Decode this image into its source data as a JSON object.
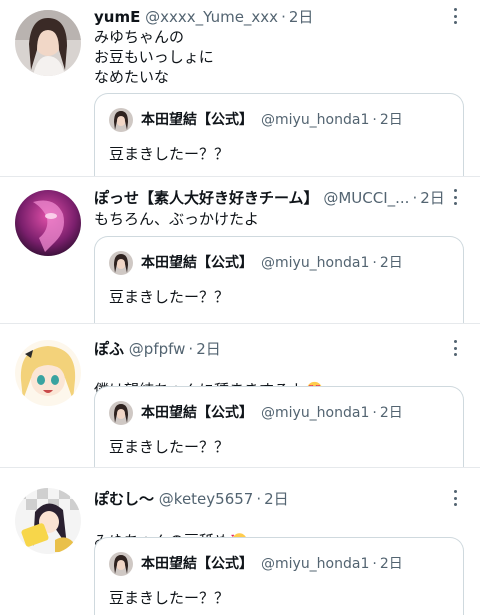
{
  "tweets": [
    {
      "name": "yumE",
      "handle": "@xxxx_Yume_xxx",
      "time": "2日",
      "text": "みゆちゃんの\nお豆もいっしょに\nなめたいな",
      "emoji": "",
      "quote": {
        "name": "本田望結【公式】",
        "handle": "@miyu_honda1",
        "time": "2日",
        "text": "豆まきしたー？？"
      }
    },
    {
      "name": "ぽっせ【素人大好き好きチーム】",
      "handle": "@MUCCI_...",
      "time": "2日",
      "text": "もちろん、ぶっかけたよ",
      "emoji": "",
      "quote": {
        "name": "本田望結【公式】",
        "handle": "@miyu_honda1",
        "time": "2日",
        "text": "豆まきしたー？？"
      }
    },
    {
      "name": "ぽふ",
      "handle": "@pfpfw",
      "time": "2日",
      "text": "僕は望結ちゃんに種まきするよ",
      "emoji": "heart-eyes-face-icon",
      "quote": {
        "name": "本田望結【公式】",
        "handle": "@miyu_honda1",
        "time": "2日",
        "text": "豆まきしたー？？"
      }
    },
    {
      "name": "ぽむし〜",
      "handle": "@ketey5657",
      "time": "2日",
      "text": "みゆちゃんの豆舐め",
      "emoji": "smiling-face-with-hearts-icon",
      "quote": {
        "name": "本田望結【公式】",
        "handle": "@miyu_honda1",
        "time": "2日",
        "text": "豆まきしたー？？"
      }
    }
  ],
  "separator": "·",
  "colors": {
    "text": "#0f1419",
    "secondary": "#536471",
    "border": "#cfd9de",
    "divider": "#e6e9ec"
  }
}
